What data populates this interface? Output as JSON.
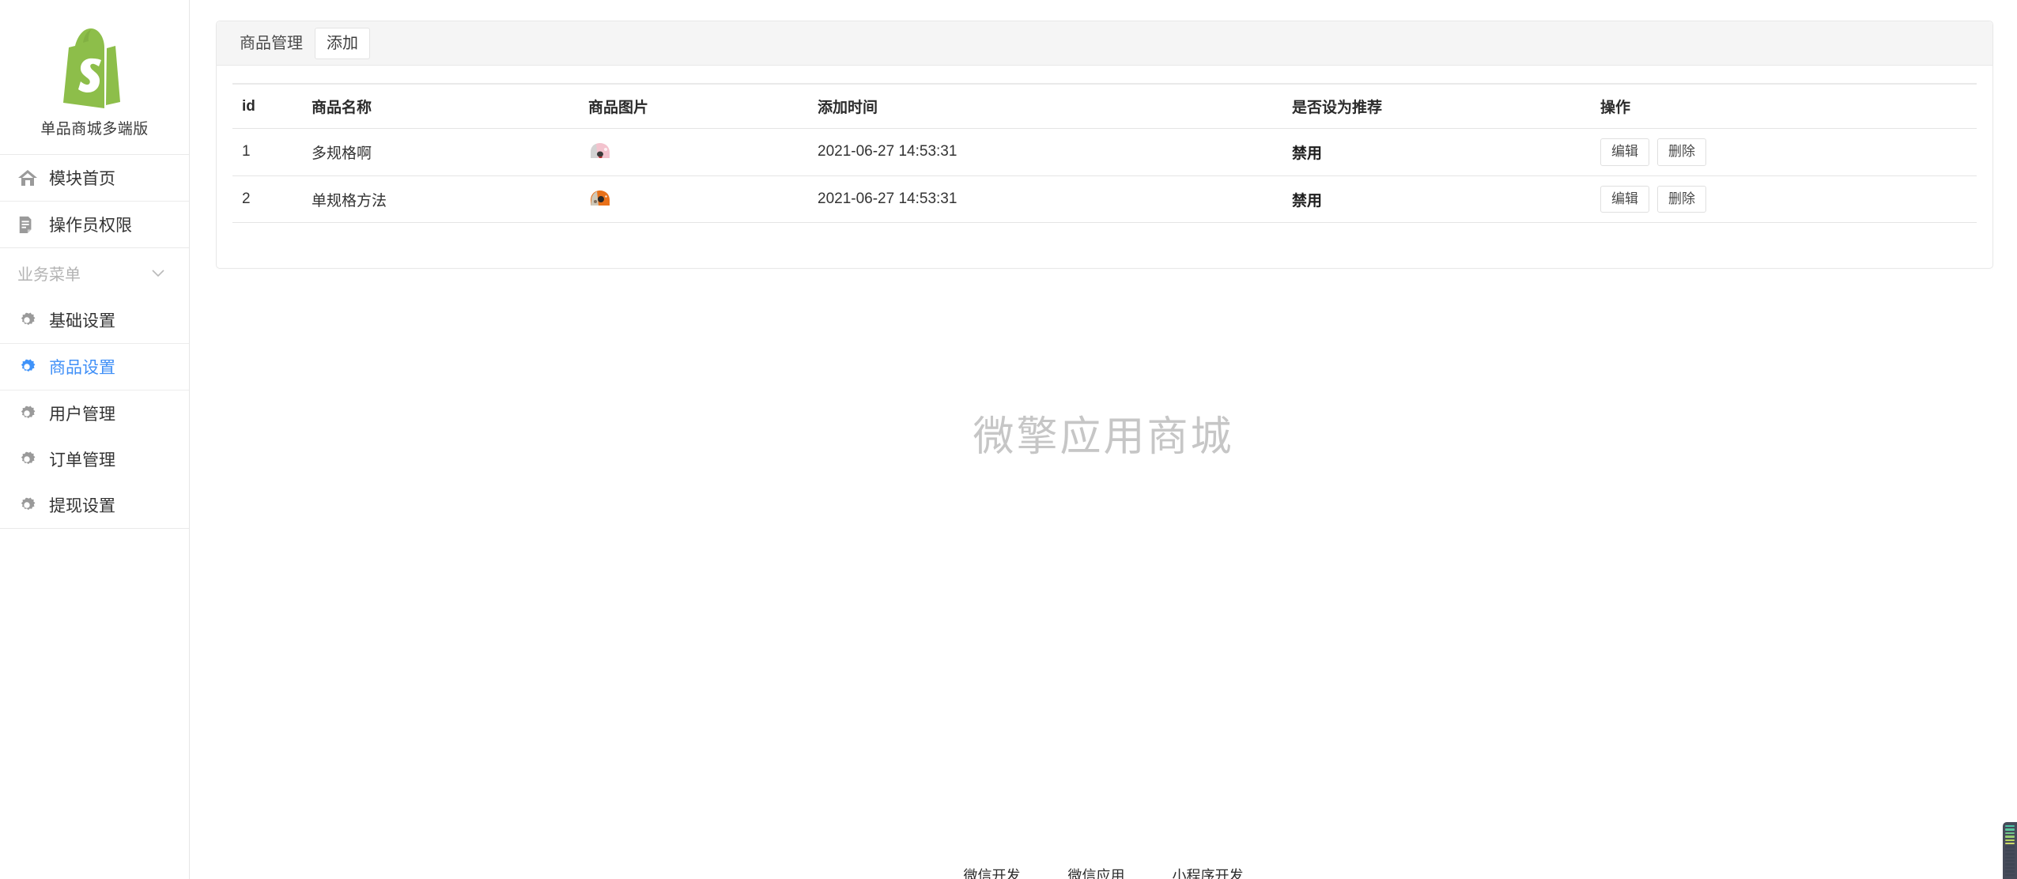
{
  "sidebar": {
    "brand": {
      "name": "单品商城多端版",
      "logo_icon": "shopify-bag-logo",
      "logo_color": "#8DBE4A"
    },
    "top_items": [
      {
        "label": "模块首页",
        "icon": "home-icon"
      },
      {
        "label": "操作员权限",
        "icon": "document-pen-icon"
      }
    ],
    "section": {
      "title": "业务菜单",
      "chevron_icon": "chevron-down-icon"
    },
    "menu_items": [
      {
        "label": "基础设置",
        "icon": "gear-icon",
        "active": false
      },
      {
        "label": "商品设置",
        "icon": "gear-icon",
        "active": true
      },
      {
        "label": "用户管理",
        "icon": "gear-icon",
        "active": false
      },
      {
        "label": "订单管理",
        "icon": "gear-icon",
        "active": false
      },
      {
        "label": "提现设置",
        "icon": "gear-icon",
        "active": false
      }
    ],
    "active_color": "#3f8ff7"
  },
  "main": {
    "tabs": [
      {
        "label": "商品管理",
        "active": false
      },
      {
        "label": "添加",
        "active": true
      }
    ],
    "table": {
      "columns": [
        "id",
        "商品名称",
        "商品图片",
        "添加时间",
        "是否设为推荐",
        "操作"
      ],
      "rows": [
        {
          "id": "1",
          "name": "多规格啊",
          "image_name": "helmet-pink-thumbnail",
          "image_colors": [
            "#f2c6cf",
            "#d9d9d9",
            "#3b3b3b"
          ],
          "time": "2021-06-27 14:53:31",
          "recommend": "禁用",
          "edit_label": "编辑",
          "delete_label": "删除"
        },
        {
          "id": "2",
          "name": "单规格方法",
          "image_name": "helmet-orange-thumbnail",
          "image_colors": [
            "#e8711a",
            "#cfc8b8",
            "#2a2a2a"
          ],
          "time": "2021-06-27 14:53:31",
          "recommend": "禁用",
          "edit_label": "编辑",
          "delete_label": "删除"
        }
      ]
    },
    "watermark": "微擎应用商城"
  },
  "footer": {
    "links": [
      "微信开发",
      "微信应用",
      "小程序开发"
    ]
  },
  "widget": {
    "name": "level-meter",
    "colors": [
      "#3f4654",
      "#3f4654",
      "#3f4654",
      "#3f4654",
      "#3f4654",
      "#3f4654",
      "#3f4654",
      "#3f4654",
      "#3f4654",
      "#cddb6a",
      "#b8d65e",
      "#96cf72",
      "#72c78c",
      "#5bc59d",
      "#4cc3a6"
    ]
  }
}
